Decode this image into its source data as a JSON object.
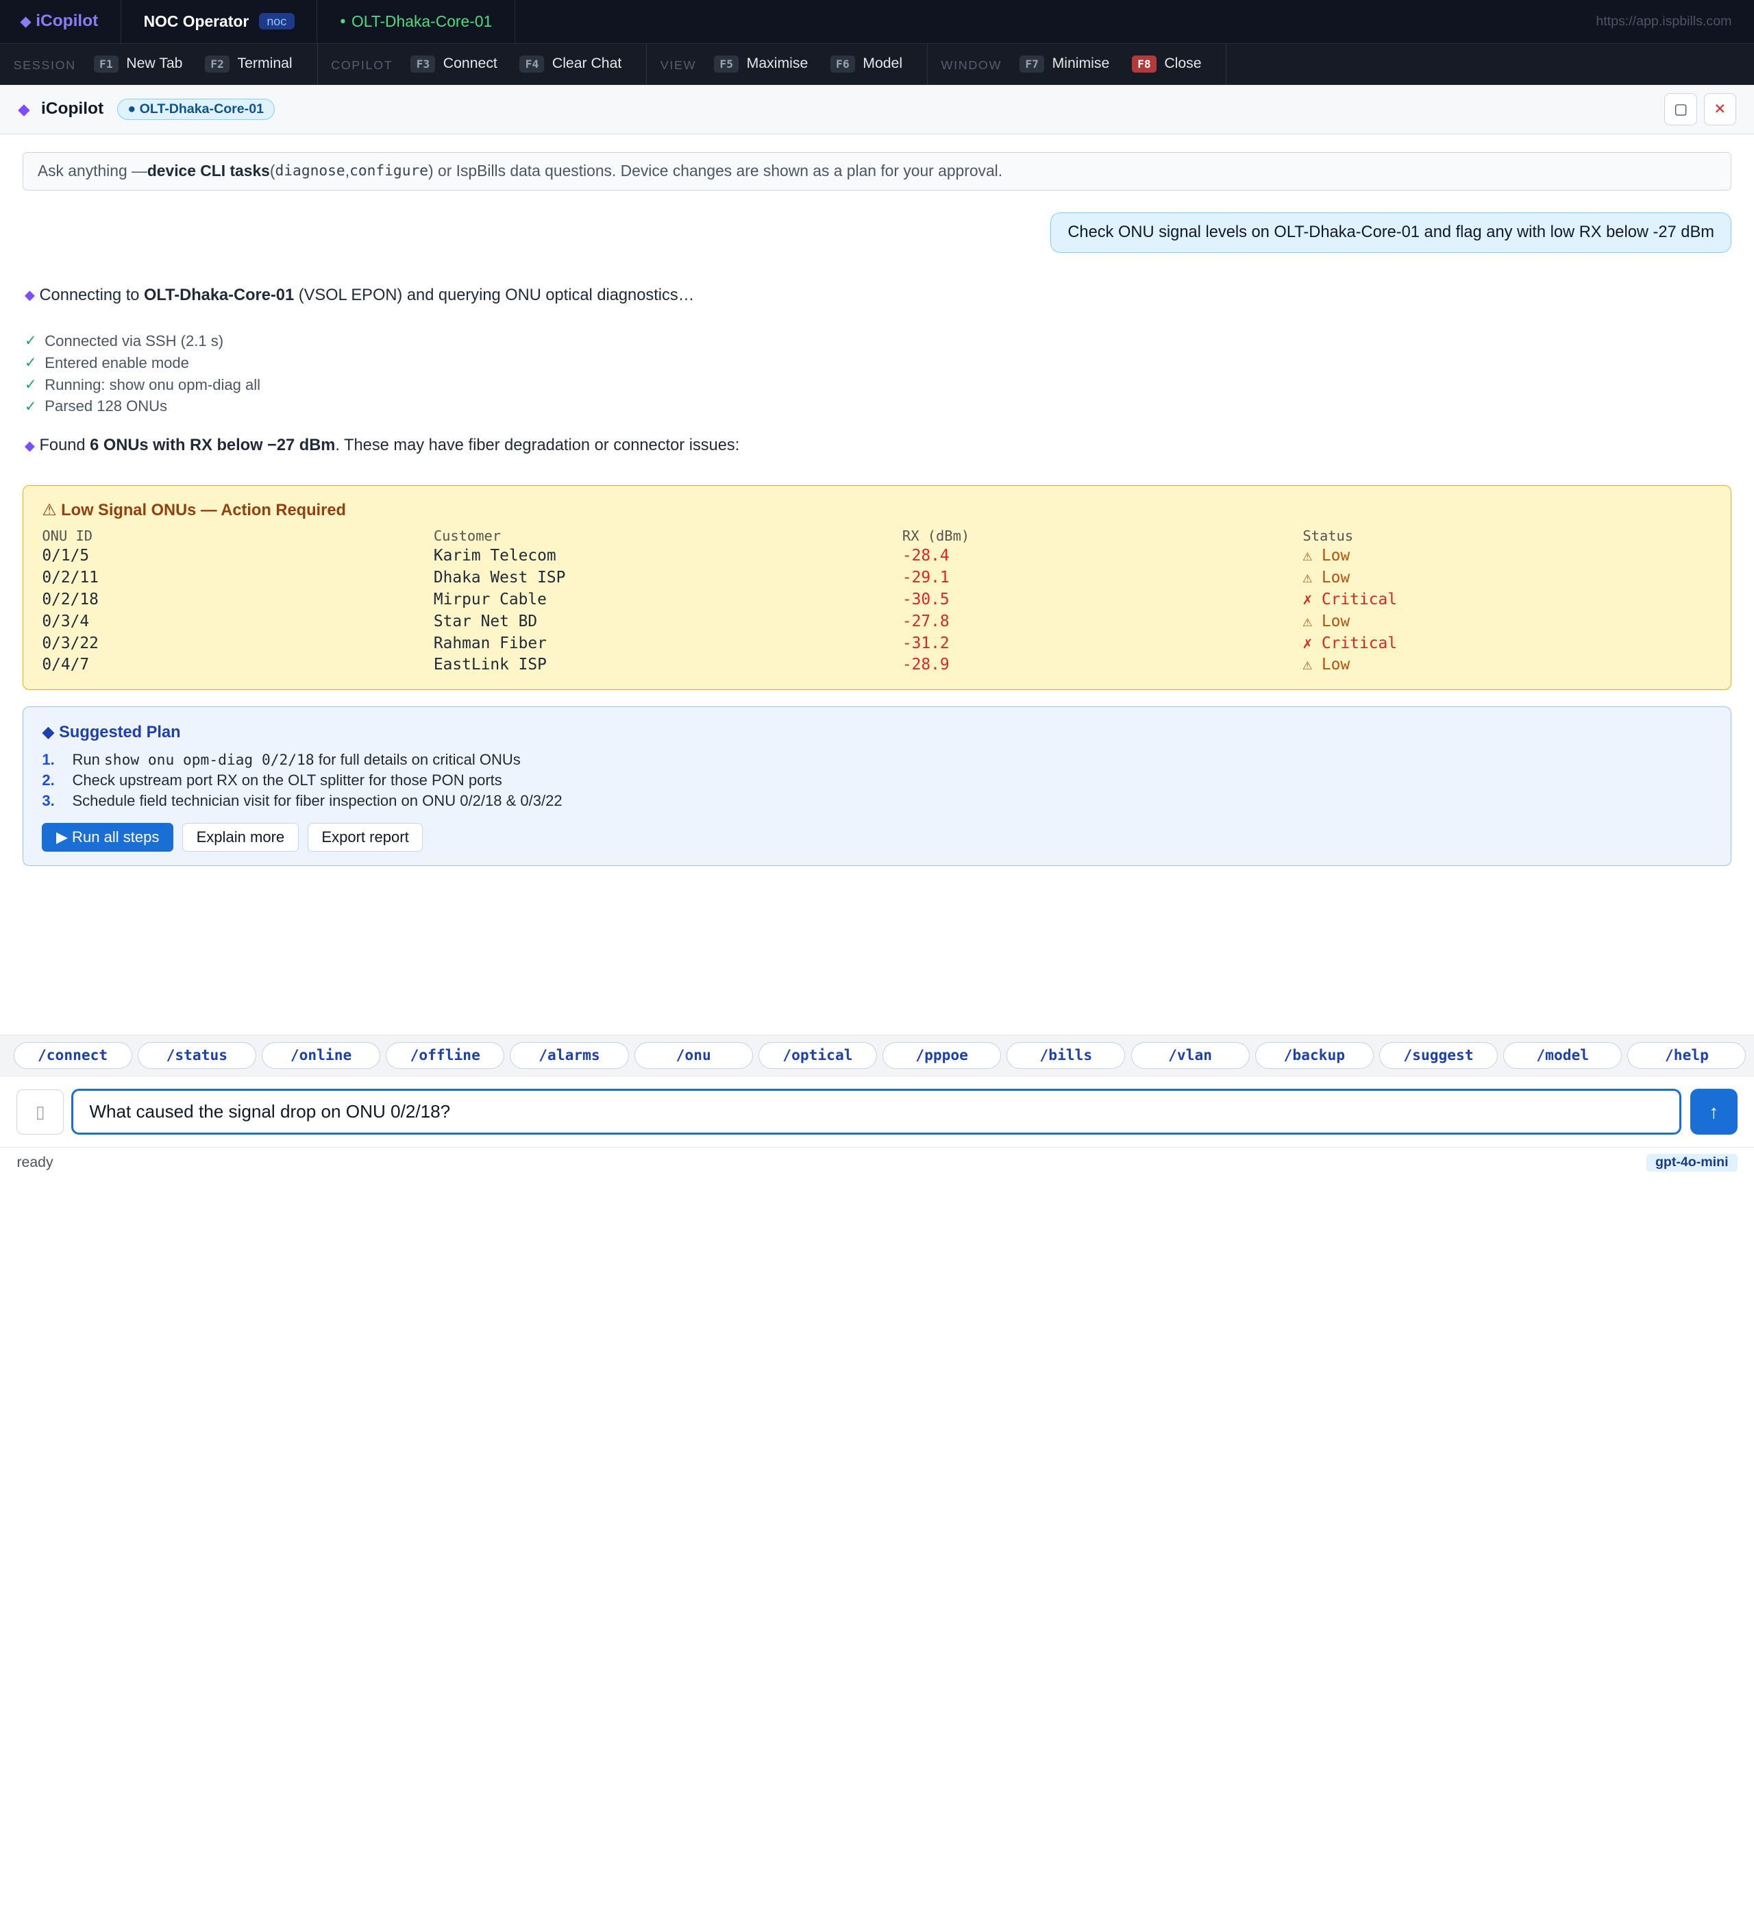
{
  "topbar": {
    "brand": "iCopilot",
    "noc_tab": "NOC Operator",
    "noc_badge": "noc",
    "device_tab": "OLT-Dhaka-Core-01",
    "url": "https://app.ispbills.com"
  },
  "fbar": {
    "groups": [
      {
        "label": "SESSION",
        "keys": [
          {
            "k": "F1",
            "t": "New Tab"
          },
          {
            "k": "F2",
            "t": "Terminal"
          }
        ]
      },
      {
        "label": "COPILOT",
        "keys": [
          {
            "k": "F3",
            "t": "Connect"
          },
          {
            "k": "F4",
            "t": "Clear Chat"
          }
        ]
      },
      {
        "label": "VIEW",
        "keys": [
          {
            "k": "F5",
            "t": "Maximise"
          },
          {
            "k": "F6",
            "t": "Model"
          }
        ]
      },
      {
        "label": "WINDOW",
        "keys": [
          {
            "k": "F7",
            "t": "Minimise"
          },
          {
            "k": "F8",
            "t": "Close"
          }
        ]
      }
    ]
  },
  "panel": {
    "title": "iCopilot",
    "device_pill": "● OLT-Dhaka-Core-01",
    "maximize_icon": "▢",
    "close_icon": "✕"
  },
  "hint": {
    "prefix": "Ask anything — ",
    "bold": "device CLI tasks",
    "mid1": " (",
    "code1": "diagnose",
    "comma": ", ",
    "code2": "configure",
    "suffix": ") or IspBills data questions. Device changes are shown as a plan for your approval."
  },
  "user_message": "Check ONU signal levels on OLT-Dhaka-Core-01 and flag any with low RX below -27 dBm",
  "assistant": {
    "connect_pre": "Connecting to ",
    "connect_bold": "OLT-Dhaka-Core-01",
    "connect_post": " (VSOL EPON) and querying ONU optical diagnostics…",
    "steps": [
      "Connected via SSH (2.1 s)",
      "Entered enable mode",
      "Running: show onu opm-diag all",
      "Parsed 128 ONUs"
    ],
    "found_pre": "Found ",
    "found_bold": "6 ONUs with RX below −27 dBm",
    "found_post": ". These may have fiber degradation or connector issues:"
  },
  "warn_table": {
    "title": "⚠ Low Signal ONUs — Action Required",
    "headers": [
      "ONU ID",
      "Customer",
      "RX (dBm)",
      "Status"
    ],
    "rows": [
      {
        "onu": "0/1/5",
        "customer": "Karim Telecom",
        "rx": "-28.4",
        "status": "⚠ Low",
        "level": "low"
      },
      {
        "onu": "0/2/11",
        "customer": "Dhaka West ISP",
        "rx": "-29.1",
        "status": "⚠ Low",
        "level": "low"
      },
      {
        "onu": "0/2/18",
        "customer": "Mirpur Cable",
        "rx": "-30.5",
        "status": "✗ Critical",
        "level": "crit"
      },
      {
        "onu": "0/3/4",
        "customer": "Star Net BD",
        "rx": "-27.8",
        "status": "⚠ Low",
        "level": "low"
      },
      {
        "onu": "0/3/22",
        "customer": "Rahman Fiber",
        "rx": "-31.2",
        "status": "✗ Critical",
        "level": "crit"
      },
      {
        "onu": "0/4/7",
        "customer": "EastLink ISP",
        "rx": "-28.9",
        "status": "⚠ Low",
        "level": "low"
      }
    ]
  },
  "plan": {
    "title": "◆ Suggested Plan",
    "step1_pre": "Run ",
    "step1_code": "show onu opm-diag 0/2/18",
    "step1_post": " for full details on critical ONUs",
    "step2": "Check upstream port RX on the OLT splitter for those PON ports",
    "step3": "Schedule field technician visit for fiber inspection on ONU 0/2/18 & 0/3/22",
    "numbers": [
      "1.",
      "2.",
      "3."
    ],
    "run_label": "▶ Run all steps",
    "explain_label": "Explain more",
    "export_label": "Export report"
  },
  "chips": [
    "/connect",
    "/status",
    "/online",
    "/offline",
    "/alarms",
    "/onu",
    "/optical",
    "/pppoe",
    "/bills",
    "/vlan",
    "/backup",
    "/suggest",
    "/model",
    "/help"
  ],
  "input": {
    "value": "What caused the signal drop on ONU 0/2/18?",
    "send_icon": "↑",
    "attach_icon": "▯"
  },
  "status": {
    "text": "ready",
    "model": "gpt-4o-mini"
  },
  "colors": {
    "accent": "#1a6fd6",
    "brand": "#8b7cf6",
    "warn_bg": "#fef6c8",
    "critical": "#dc2626"
  }
}
